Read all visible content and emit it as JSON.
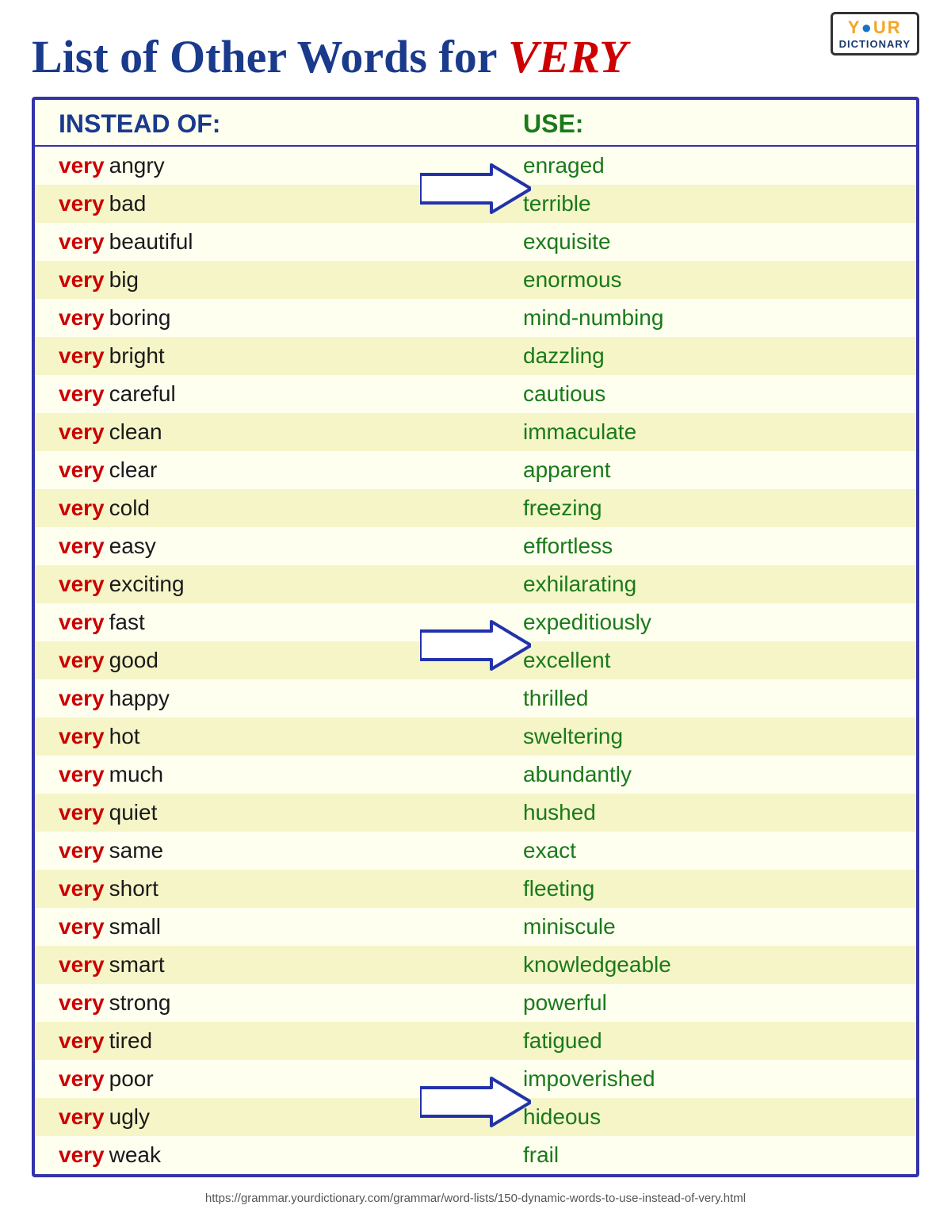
{
  "logo": {
    "your": "Y",
    "our": "OUR",
    "dot_color": "#1a73c1",
    "dictionary": "DICTIONARY"
  },
  "title": {
    "main": "List of Other Words for ",
    "highlight": "VERY"
  },
  "header": {
    "instead_label": "INSTEAD OF:",
    "use_label": "USE:"
  },
  "words": [
    {
      "very": "very",
      "adj": "angry",
      "use": "enraged",
      "arrow": false
    },
    {
      "very": "very",
      "adj": "bad",
      "use": "terrible",
      "arrow": true,
      "arrow_group": "A"
    },
    {
      "very": "very",
      "adj": "beautiful",
      "use": "exquisite",
      "arrow": false
    },
    {
      "very": "very",
      "adj": "big",
      "use": "enormous",
      "arrow": false
    },
    {
      "very": "very",
      "adj": "boring",
      "use": "mind-numbing",
      "arrow": false
    },
    {
      "very": "very",
      "adj": "bright",
      "use": "dazzling",
      "arrow": false
    },
    {
      "very": "very",
      "adj": "careful",
      "use": "cautious",
      "arrow": false
    },
    {
      "very": "very",
      "adj": "clean",
      "use": "immaculate",
      "arrow": false
    },
    {
      "very": "very",
      "adj": "clear",
      "use": "apparent",
      "arrow": false
    },
    {
      "very": "very",
      "adj": "cold",
      "use": "freezing",
      "arrow": false
    },
    {
      "very": "very",
      "adj": "easy",
      "use": "effortless",
      "arrow": false
    },
    {
      "very": "very",
      "adj": "exciting",
      "use": "exhilarating",
      "arrow": false
    },
    {
      "very": "very",
      "adj": "fast",
      "use": "expeditiously",
      "arrow": true,
      "arrow_group": "B"
    },
    {
      "very": "very",
      "adj": "good",
      "use": "excellent",
      "arrow": false
    },
    {
      "very": "very",
      "adj": "happy",
      "use": "thrilled",
      "arrow": false
    },
    {
      "very": "very",
      "adj": "hot",
      "use": "sweltering",
      "arrow": false
    },
    {
      "very": "very",
      "adj": "much",
      "use": "abundantly",
      "arrow": false
    },
    {
      "very": "very",
      "adj": "quiet",
      "use": "hushed",
      "arrow": false
    },
    {
      "very": "very",
      "adj": "same",
      "use": "exact",
      "arrow": false
    },
    {
      "very": "very",
      "adj": "short",
      "use": "fleeting",
      "arrow": false
    },
    {
      "very": "very",
      "adj": "small",
      "use": "miniscule",
      "arrow": false
    },
    {
      "very": "very",
      "adj": "smart",
      "use": "knowledgeable",
      "arrow": false
    },
    {
      "very": "very",
      "adj": "strong",
      "use": "powerful",
      "arrow": false
    },
    {
      "very": "very",
      "adj": "tired",
      "use": "fatigued",
      "arrow": false
    },
    {
      "very": "very",
      "adj": "poor",
      "use": "impoverished",
      "arrow": true,
      "arrow_group": "C"
    },
    {
      "very": "very",
      "adj": "ugly",
      "use": "hideous",
      "arrow": false
    },
    {
      "very": "very",
      "adj": "weak",
      "use": "frail",
      "arrow": false
    }
  ],
  "footer_url": "https://grammar.yourdictionary.com/grammar/word-lists/150-dynamic-words-to-use-instead-of-very.html",
  "arrow_groups": {
    "A": {
      "rows": [
        0,
        1
      ],
      "label": "arrow-group-A"
    },
    "B": {
      "rows": [
        12,
        13
      ],
      "label": "arrow-group-B"
    },
    "C": {
      "rows": [
        24,
        25
      ],
      "label": "arrow-group-C"
    }
  }
}
